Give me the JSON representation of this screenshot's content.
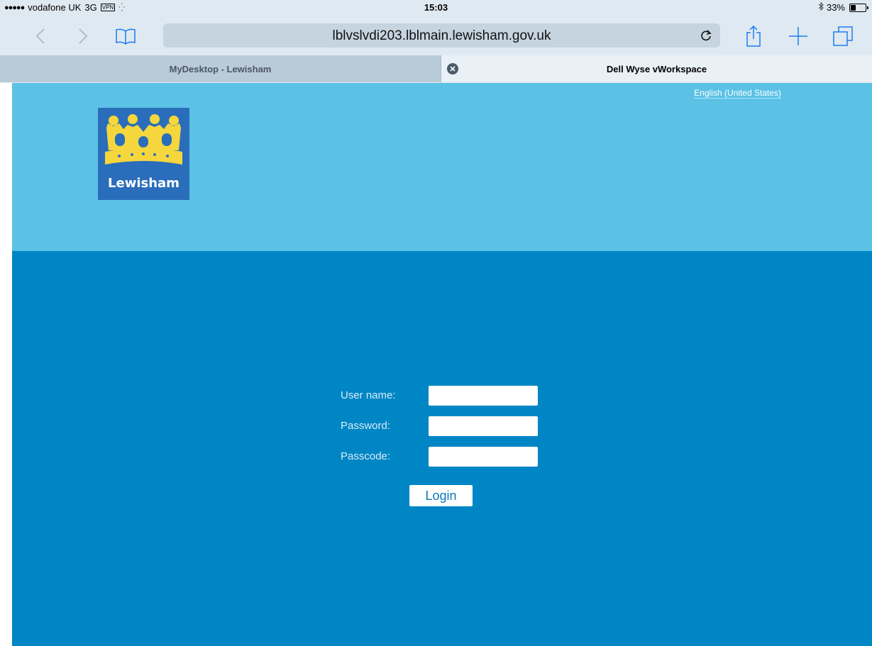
{
  "status_bar": {
    "signal": "●●●●●",
    "carrier": "vodafone UK",
    "network": "3G",
    "vpn": "VPN",
    "time": "15:03",
    "battery_percent": "33%",
    "battery_level": 0.33
  },
  "browser": {
    "url": "lblvslvdi203.lblmain.lewisham.gov.uk",
    "icons": {
      "back": "back-chevron-icon",
      "forward": "forward-chevron-icon",
      "bookmarks": "book-icon",
      "reload": "reload-icon",
      "share": "share-icon",
      "new_tab": "plus-icon",
      "tabs": "tabs-icon"
    },
    "tabs": [
      {
        "label": "MyDesktop - Lewisham",
        "active": false
      },
      {
        "label": "Dell Wyse vWorkspace",
        "active": true
      }
    ]
  },
  "page": {
    "language_link": "English (United States)",
    "logo_text": "Lewisham",
    "form": {
      "username_label": "User name:",
      "username_value": "",
      "password_label": "Password:",
      "password_value": "",
      "passcode_label": "Passcode:",
      "passcode_value": "",
      "login_button": "Login"
    }
  },
  "colors": {
    "header_bg": "#5bc2e6",
    "main_bg": "#0086c5",
    "logo_bg": "#2a6ebb",
    "crown": "#f5d63d",
    "chrome": "#dfe9f1"
  }
}
